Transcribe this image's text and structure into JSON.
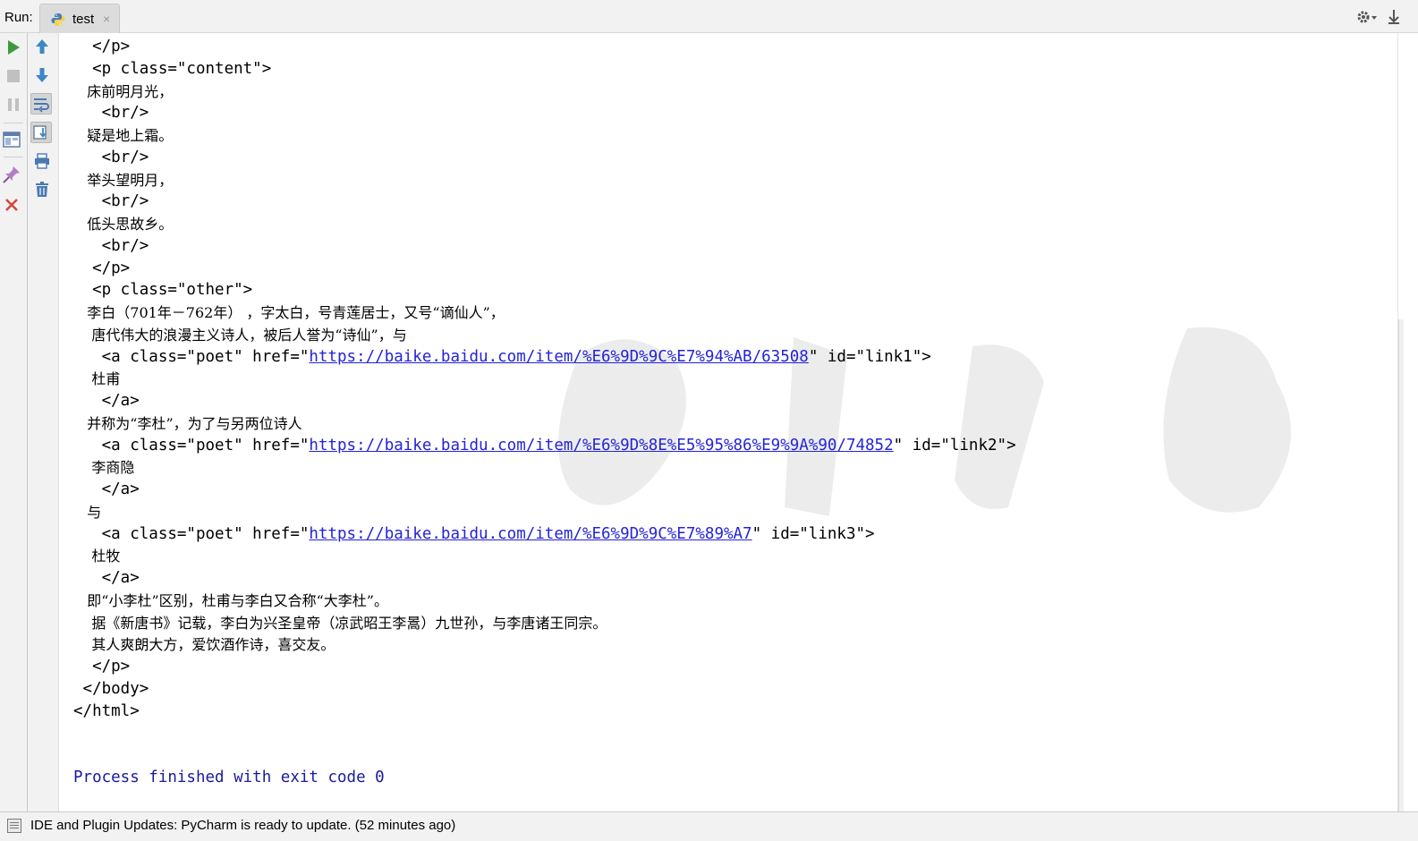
{
  "topbar": {
    "run_label": "Run:",
    "tab_label": "test",
    "tab_close": "×",
    "tab_icon": "python-icon",
    "settings_icon": "gear-icon",
    "hide_icon": "pin-icon"
  },
  "left_toolbar": {
    "col1": [
      "rerun-icon",
      "stop-icon",
      "pause-icon",
      "restore-layout-icon",
      "pin-tab-icon",
      "close-icon"
    ],
    "col2": [
      "up-arrow-icon",
      "down-arrow-icon",
      "soft-wrap-icon",
      "scroll-to-end-icon",
      "print-icon",
      "trash-icon"
    ]
  },
  "console": {
    "lines": [
      {
        "t": "  </p>"
      },
      {
        "t": "  <p class=\"content\">"
      },
      {
        "t": "   床前明月光，",
        "cjk": true
      },
      {
        "t": "   <br/>"
      },
      {
        "t": "   疑是地上霜。",
        "cjk": true
      },
      {
        "t": "   <br/>"
      },
      {
        "t": "   举头望明月，",
        "cjk": true
      },
      {
        "t": "   <br/>"
      },
      {
        "t": "   低头思故乡。",
        "cjk": true
      },
      {
        "t": "   <br/>"
      },
      {
        "t": "  </p>"
      },
      {
        "t": "  <p class=\"other\">"
      },
      {
        "t": "   李白（701年－762年） ，字太白，号青莲居士，又号“谪仙人”，",
        "cjk": true
      },
      {
        "t": "    唐代伟大的浪漫主义诗人，被后人誉为“诗仙”，与",
        "cjk": true
      },
      {
        "pre": "   <a class=\"poet\" href=\"",
        "link": "https://baike.baidu.com/item/%E6%9D%9C%E7%94%AB/63508",
        "post": "\" id=\"link1\">"
      },
      {
        "t": "    杜甫",
        "cjk": true
      },
      {
        "t": "   </a>"
      },
      {
        "t": "   并称为“李杜”，为了与另两位诗人",
        "cjk": true
      },
      {
        "pre": "   <a class=\"poet\" href=\"",
        "link": "https://baike.baidu.com/item/%E6%9D%8E%E5%95%86%E9%9A%90/74852",
        "post": "\" id=\"link2\">"
      },
      {
        "t": "    李商隐",
        "cjk": true
      },
      {
        "t": "   </a>"
      },
      {
        "t": "   与",
        "cjk": true
      },
      {
        "pre": "   <a class=\"poet\" href=\"",
        "link": "https://baike.baidu.com/item/%E6%9D%9C%E7%89%A7",
        "post": "\" id=\"link3\">"
      },
      {
        "t": "    杜牧",
        "cjk": true
      },
      {
        "t": "   </a>"
      },
      {
        "t": "   即“小李杜”区别，杜甫与李白又合称“大李杜”。",
        "cjk": true
      },
      {
        "t": "    据《新唐书》记载，李白为兴圣皇帝（凉武昭王李暠）九世孙，与李唐诸王同宗。",
        "cjk": true
      },
      {
        "t": "    其人爽朗大方，爱饮酒作诗，喜交友。",
        "cjk": true
      },
      {
        "t": "  </p>"
      },
      {
        "t": " </body>"
      },
      {
        "t": "</html>"
      }
    ],
    "process_message": "Process finished with exit code 0"
  },
  "statusbar": {
    "text": "IDE and Plugin Updates: PyCharm is ready to update. (52 minutes ago)"
  }
}
